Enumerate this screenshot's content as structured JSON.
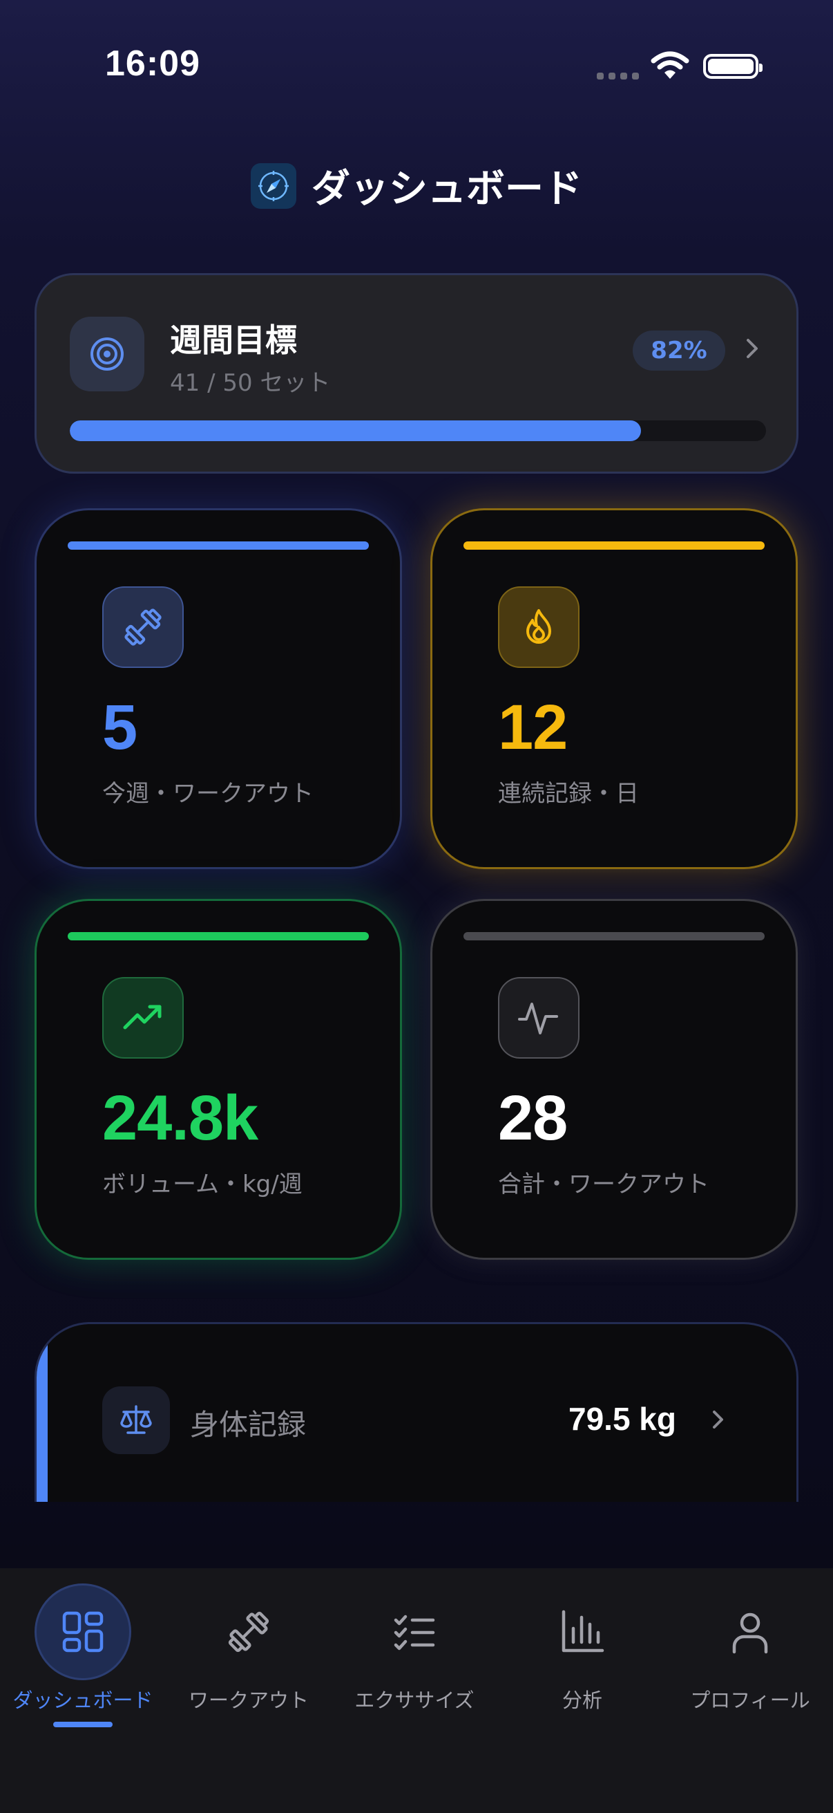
{
  "status_bar": {
    "time": "16:09"
  },
  "header": {
    "title": "ダッシュボード",
    "icon": "compass-icon"
  },
  "weekly_goal": {
    "title": "週間目標",
    "subtitle": "41 / 50 セット",
    "percent_label": "82%",
    "progress": 0.82,
    "icon": "target-icon"
  },
  "stats": [
    {
      "value": "5",
      "label": "今週・ワークアウト",
      "icon": "dumbbell-icon",
      "color": "#4f86f7"
    },
    {
      "value": "12",
      "label": "連続記録・日",
      "icon": "flame-icon",
      "color": "#f6b90e"
    },
    {
      "value": "24.8k",
      "label": "ボリューム・kg/週",
      "icon": "trending-up-icon",
      "color": "#1fd360"
    },
    {
      "value": "28",
      "label": "合計・ワークアウト",
      "icon": "activity-icon",
      "color": "#ffffff"
    }
  ],
  "body_record": {
    "label": "身体記録",
    "value": "79.5 kg",
    "icon": "scale-icon"
  },
  "tabs": [
    {
      "label": "ダッシュボード",
      "icon": "grid-icon",
      "active": true
    },
    {
      "label": "ワークアウト",
      "icon": "dumbbell-icon",
      "active": false
    },
    {
      "label": "エクササイズ",
      "icon": "checklist-icon",
      "active": false
    },
    {
      "label": "分析",
      "icon": "bar-chart-icon",
      "active": false
    },
    {
      "label": "プロフィール",
      "icon": "user-icon",
      "active": false
    }
  ]
}
